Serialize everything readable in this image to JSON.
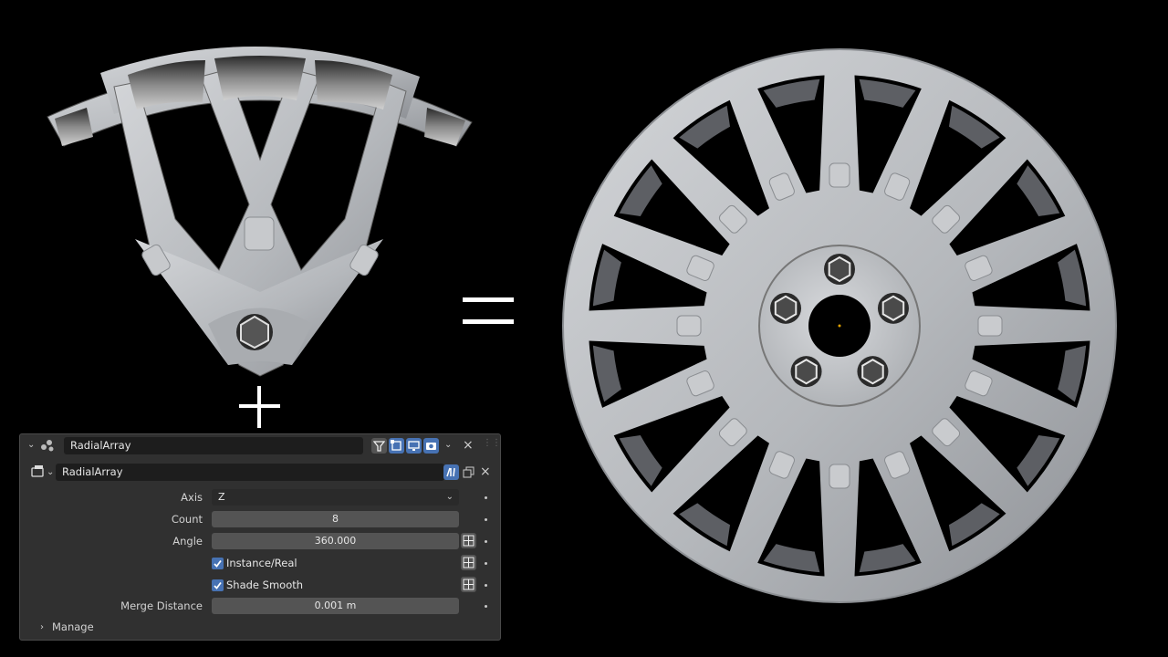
{
  "scene": {
    "equals_symbol": "=",
    "plus_symbol": "+"
  },
  "panel": {
    "modifier_name": "RadialArray",
    "node_group_name": "RadialArray",
    "axis_label": "Axis",
    "axis_value": "Z",
    "count_label": "Count",
    "count_value": "8",
    "angle_label": "Angle",
    "angle_value": "360.000",
    "instance_label": "Instance/Real",
    "instance_checked": true,
    "smooth_label": "Shade Smooth",
    "smooth_checked": true,
    "merge_label": "Merge Distance",
    "merge_value": "0.001 m",
    "manage_label": "Manage"
  },
  "colors": {
    "accent": "#4772b3",
    "panel_bg": "#303030",
    "metal": "#b9bcc0"
  }
}
